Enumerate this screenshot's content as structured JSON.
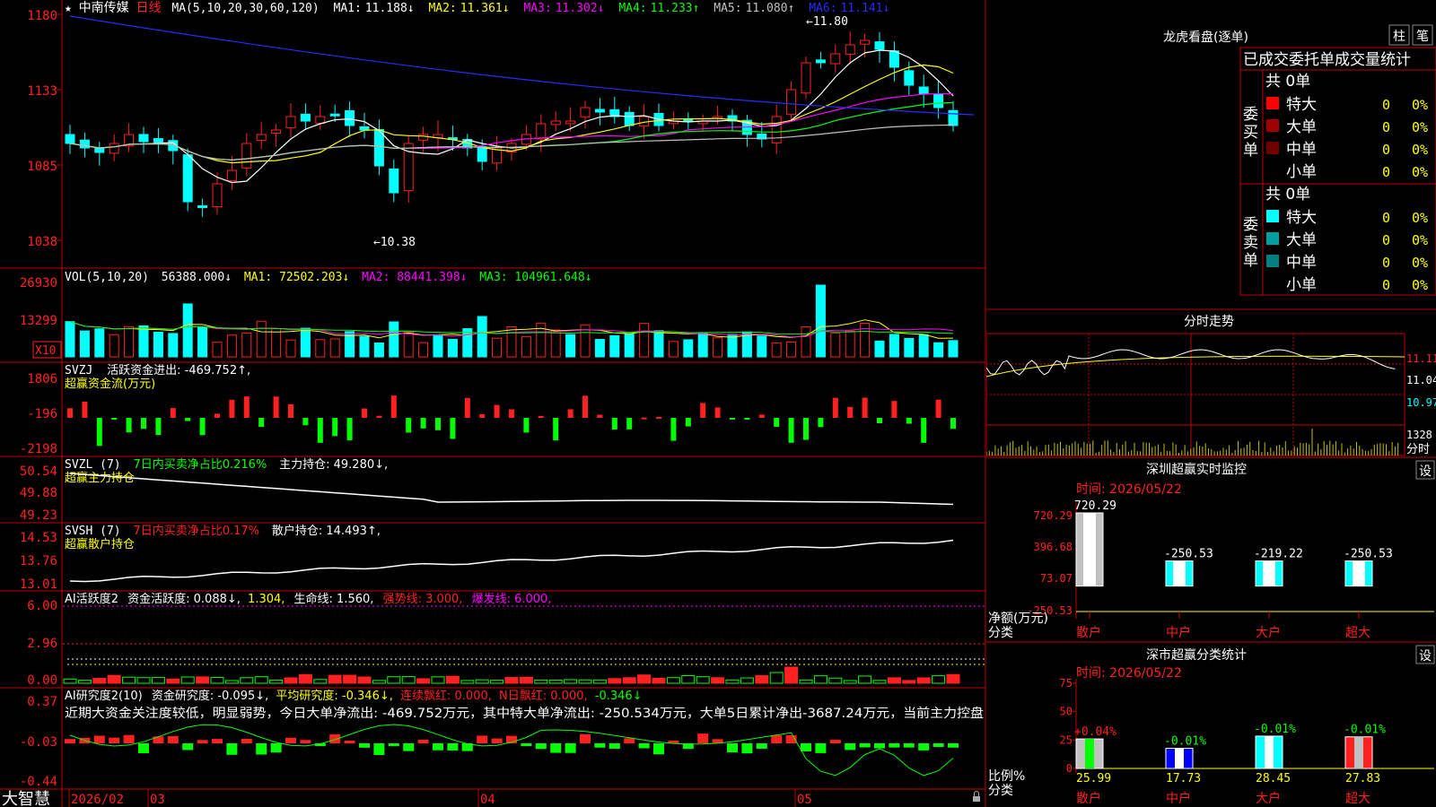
{
  "colors": {
    "up": "#ff2020",
    "down": "#00ffff",
    "ma1": "#ffffff",
    "ma2": "#ffff00",
    "ma3": "#ff00ff",
    "ma4": "#00ff00",
    "ma5": "#c0c0c0",
    "ma6": "#2a2aff",
    "grid": "#c00000",
    "dim": "#909090"
  },
  "header": {
    "star": "★",
    "stock": "中南传媒",
    "period": "日线",
    "ma_label": "MA(5,10,20,30,60,120)",
    "ma": [
      {
        "k": "MA1:",
        "v": "11.188↓"
      },
      {
        "k": "MA2:",
        "v": "11.361↓"
      },
      {
        "k": "MA3:",
        "v": "11.302↓"
      },
      {
        "k": "MA4:",
        "v": "11.233↑"
      },
      {
        "k": "MA5:",
        "v": "11.080↑"
      },
      {
        "k": "MA6:",
        "v": "11.141↓"
      }
    ]
  },
  "price_panel": {
    "yticks": [
      "1180",
      "1133",
      "1085",
      "1038"
    ],
    "high_mark": "11.80",
    "low_mark": "10.38"
  },
  "vol_panel": {
    "label": "VOL(5,10,20)",
    "value": "56388.000↓",
    "ma1": "MA1: 72502.203↓",
    "ma2": "MA2: 88441.398↓",
    "ma3": "MA3: 104961.648↓",
    "yticks": [
      "26930",
      "13299"
    ],
    "unit": "X10"
  },
  "svzj_panel": {
    "label": "SVZJ",
    "text": "活跃资金进出: -469.752↑,",
    "sub": "超赢资金流(万元)",
    "yticks": [
      "1806",
      "-196",
      "-2198"
    ]
  },
  "svzl_panel": {
    "label": "SVZL (7)",
    "text": "7日内买卖净占比0.216%",
    "text2": "主力持仓: 49.280↓,",
    "sub": "超赢主力持仓",
    "yticks": [
      "50.54",
      "49.88",
      "49.23"
    ]
  },
  "svsh_panel": {
    "label": "SVSH (7)",
    "text": "7日内买卖净占比0.17%",
    "text2": "散户持仓: 14.493↑,",
    "sub": "超赢散户持仓",
    "yticks": [
      "14.53",
      "13.76",
      "13.01"
    ]
  },
  "ai_panel": {
    "label": "AI活跃度2",
    "t1": "资金活跃度: 0.088↓,",
    "t2": "1.304,",
    "t3": "生命线: 1.560,",
    "t4": "强势线: 3.000,",
    "t5": "爆发线: 6.000,",
    "yticks": [
      "6.00",
      "2.96",
      "0.00"
    ]
  },
  "research_panel": {
    "label": "AI研究度2(10)",
    "t1": "资金研究度: -0.095↓,",
    "t2": "平均研究度: -0.346↓,",
    "t3": "连续飘红: 0.000,",
    "t4": "N日飘红: 0.000,",
    "t5": "-0.346↓",
    "comment": "近期大资金关注度较低，明显弱势，今日大单净流出: -469.752万元，其中特大单净流出: -250.534万元，大单5日累计净出-3687.24万元，当前主力控盘",
    "yticks": [
      "0.37",
      "-0.03",
      "-0.44"
    ]
  },
  "bottom": {
    "brand": "大智慧",
    "dates": [
      "2026/02",
      "03",
      "04",
      "05"
    ]
  },
  "right": {
    "title": "龙虎看盘(逐单)",
    "btn1": "柱",
    "btn2": "笔",
    "table_title": "已成交委托单成交量统计",
    "buy": {
      "side": "委买单",
      "total": "共 0单",
      "rows": [
        {
          "n": "特大",
          "c": "#ff0000",
          "v": "0",
          "p": "0%"
        },
        {
          "n": "大单",
          "c": "#a00000",
          "v": "0",
          "p": "0%"
        },
        {
          "n": "中单",
          "c": "#700000",
          "v": "0",
          "p": "0%"
        },
        {
          "n": "小单",
          "c": "",
          "v": "0",
          "p": "0%"
        }
      ]
    },
    "sell": {
      "side": "委卖单",
      "total": "共 0单",
      "rows": [
        {
          "n": "特大",
          "c": "#00ffff",
          "v": "0",
          "p": "0%"
        },
        {
          "n": "大单",
          "c": "#00a0a0",
          "v": "0",
          "p": "0%"
        },
        {
          "n": "中单",
          "c": "#008080",
          "v": "0",
          "p": "0%"
        },
        {
          "n": "小单",
          "c": "",
          "v": "0",
          "p": "0%"
        }
      ]
    },
    "intraday_title": "分时走势",
    "intraday_ticks": [
      "11.11",
      "11.04",
      "10.97"
    ],
    "intraday_vol": "1328",
    "intraday_unit": "分时",
    "monitor": {
      "title": "深圳超赢实时监控",
      "btn": "设",
      "date": "时间: 2026/05/22",
      "yticks": [
        "720.29",
        "396.68",
        "73.07",
        "-250.53"
      ],
      "ylabel": "净额(万元)",
      "xlabel": "分类",
      "bars": [
        {
          "name": "散户",
          "value": 720.29,
          "label": "720.29"
        },
        {
          "name": "中户",
          "value": -250.53,
          "label": "-250.53"
        },
        {
          "name": "大户",
          "value": -219.22,
          "label": "-219.22"
        },
        {
          "name": "超大",
          "value": -250.53,
          "label": "-250.53"
        }
      ]
    },
    "classify": {
      "title": "深市超赢分类统计",
      "btn": "设",
      "date": "时间: 2026/05/22",
      "yticks": [
        "75",
        "50",
        "25",
        "0"
      ],
      "ylabel": "比例%",
      "xlabel": "分类",
      "bars": [
        {
          "name": "散户",
          "value": 25.99,
          "label": "25.99",
          "chg": "+0.04%"
        },
        {
          "name": "中户",
          "value": 17.73,
          "label": "17.73",
          "chg": "-0.01%"
        },
        {
          "name": "大户",
          "value": 28.45,
          "label": "28.45",
          "chg": "-0.01%"
        },
        {
          "name": "超大",
          "value": 27.83,
          "label": "27.83",
          "chg": "-0.01%"
        }
      ]
    }
  }
}
